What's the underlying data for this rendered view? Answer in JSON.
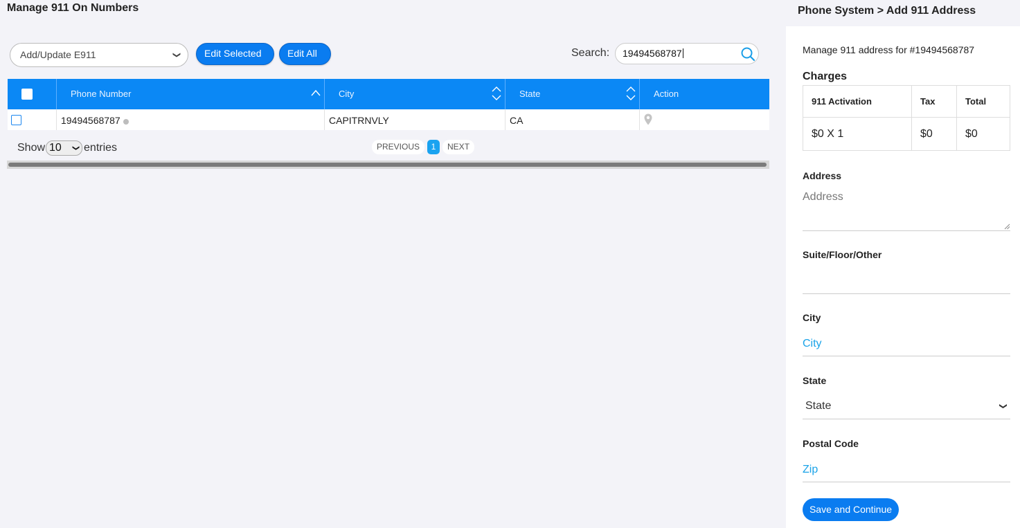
{
  "page": {
    "title": "Manage 911 On Numbers"
  },
  "toolbar": {
    "bulk_action": "Add/Update E911",
    "edit_selected_label": "Edit Selected",
    "edit_all_label": "Edit All",
    "search_label": "Search:",
    "search_value": "19494568787"
  },
  "table": {
    "columns": [
      "Phone Number",
      "City",
      "State",
      "Action"
    ],
    "rows": [
      {
        "phone": "19494568787",
        "city": "CAPITRNVLY",
        "state": "CA"
      }
    ]
  },
  "footer": {
    "show_label": "Show",
    "entries_value": "10",
    "entries_label": "entries",
    "prev_label": "PREVIOUS",
    "page_number": "1",
    "next_label": "NEXT"
  },
  "side": {
    "breadcrumb": "Phone System > Add 911 Address",
    "manage_text": "Manage 911 address for #19494568787",
    "charges_title": "Charges",
    "charges": {
      "headers": [
        "911 Activation",
        "Tax",
        "Total"
      ],
      "values": [
        "$0 X 1",
        "$0",
        "$0"
      ]
    },
    "address_label": "Address",
    "address_placeholder": "Address",
    "suite_label": "Suite/Floor/Other",
    "city_label": "City",
    "city_placeholder": "City",
    "state_label": "State",
    "state_value": "State",
    "postal_label": "Postal Code",
    "postal_placeholder": "Zip",
    "save_label": "Save and Continue"
  },
  "colors": {
    "accent": "#0a7cf0",
    "header_bg": "#0b88f5",
    "link": "#1aa3e8"
  }
}
